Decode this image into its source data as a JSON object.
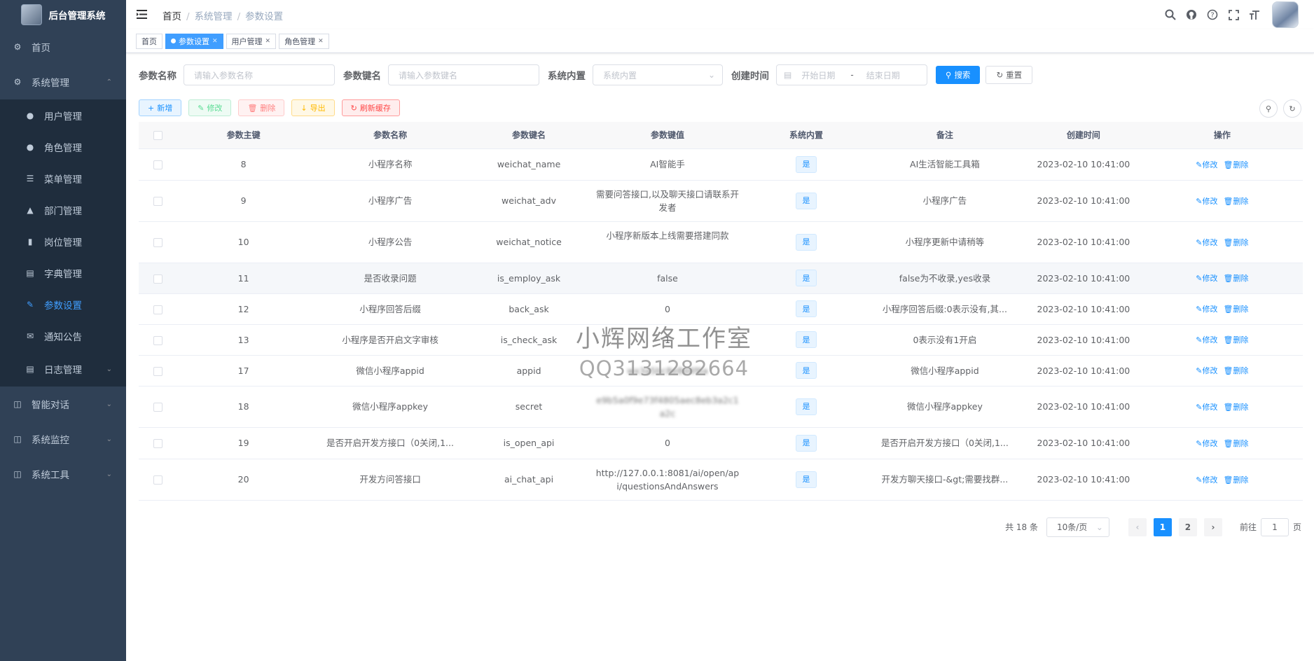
{
  "app": {
    "title": "后台管理系统"
  },
  "sidebar": {
    "home": "首页",
    "system": "系统管理",
    "sub": [
      {
        "label": "用户管理",
        "icon": "user-icon"
      },
      {
        "label": "角色管理",
        "icon": "peoples-icon"
      },
      {
        "label": "菜单管理",
        "icon": "tree-table-icon"
      },
      {
        "label": "部门管理",
        "icon": "tree-icon"
      },
      {
        "label": "岗位管理",
        "icon": "post-icon"
      },
      {
        "label": "字典管理",
        "icon": "dict-icon"
      },
      {
        "label": "参数设置",
        "icon": "edit-icon"
      },
      {
        "label": "通知公告",
        "icon": "message-icon"
      },
      {
        "label": "日志管理",
        "icon": "log-icon"
      }
    ],
    "chat": "智能对话",
    "monitor": "系统监控",
    "tools": "系统工具"
  },
  "breadcrumb": [
    "首页",
    "系统管理",
    "参数设置"
  ],
  "tags": [
    "首页",
    "参数设置",
    "用户管理",
    "角色管理"
  ],
  "search": {
    "name_label": "参数名称",
    "name_ph": "请输入参数名称",
    "key_label": "参数键名",
    "key_ph": "请输入参数键名",
    "type_label": "系统内置",
    "type_ph": "系统内置",
    "date_label": "创建时间",
    "date_start": "开始日期",
    "date_sep": "-",
    "date_end": "结束日期",
    "search_btn": "搜索",
    "reset_btn": "重置"
  },
  "toolbar": {
    "add": "新增",
    "edit": "修改",
    "delete": "删除",
    "export": "导出",
    "refresh": "刷新缓存"
  },
  "table": {
    "headers": [
      "参数主键",
      "参数名称",
      "参数键名",
      "参数键值",
      "系统内置",
      "备注",
      "创建时间",
      "操作"
    ],
    "edit": "修改",
    "del": "删除",
    "rows": [
      {
        "id": "8",
        "name": "小程序名称",
        "key": "weichat_name",
        "value": "AI智能手",
        "type": "是",
        "remark": "AI生活智能工具箱",
        "time": "2023-02-10 10:41:00"
      },
      {
        "id": "9",
        "name": "小程序广告",
        "key": "weichat_adv",
        "value": "需要问答接口,以及聊天接口请联系开发者",
        "type": "是",
        "remark": "小程序广告",
        "time": "2023-02-10 10:41:00"
      },
      {
        "id": "10",
        "name": "小程序公告",
        "key": "weichat_notice",
        "value": "小程序新版本上线需要搭建同款",
        "type": "是",
        "remark": "小程序更新中请稍等",
        "time": "2023-02-10 10:41:00"
      },
      {
        "id": "11",
        "name": "是否收录问题",
        "key": "is_employ_ask",
        "value": "false",
        "type": "是",
        "remark": "false为不收录,yes收录",
        "time": "2023-02-10 10:41:00"
      },
      {
        "id": "12",
        "name": "小程序回答后缀",
        "key": "back_ask",
        "value": "0",
        "type": "是",
        "remark": "小程序回答后缀:0表示没有,其...",
        "time": "2023-02-10 10:41:00"
      },
      {
        "id": "13",
        "name": "小程序是否开启文字审核",
        "key": "is_check_ask",
        "value": "1",
        "type": "是",
        "remark": "0表示没有1开启",
        "time": "2023-02-10 10:41:00"
      },
      {
        "id": "17",
        "name": "微信小程序appid",
        "key": "appid",
        "value": "wx3a5bc8e8d4f6a",
        "type": "是",
        "remark": "微信小程序appid",
        "time": "2023-02-10 10:41:00"
      },
      {
        "id": "18",
        "name": "微信小程序appkey",
        "key": "secret",
        "value": "e9b5a0f9e73f4805aec8eb3a2c1a2c",
        "type": "是",
        "remark": "微信小程序appkey",
        "time": "2023-02-10 10:41:00"
      },
      {
        "id": "19",
        "name": "是否开启开发方接口（0关闭,1...",
        "key": "is_open_api",
        "value": "0",
        "type": "是",
        "remark": "是否开启开发方接口（0关闭,1...",
        "time": "2023-02-10 10:41:00"
      },
      {
        "id": "20",
        "name": "开发方问答接口",
        "key": "ai_chat_api",
        "value": "http://127.0.0.1:8081/ai/open/api/questionsAndAnswers",
        "type": "是",
        "remark": "开发方聊天接口-&gt;需要找群...",
        "time": "2023-02-10 10:41:00"
      }
    ]
  },
  "pager": {
    "total": "共 18 条",
    "size": "10条/页",
    "pages": [
      "1",
      "2"
    ],
    "goto": "前往",
    "page_input": "1",
    "page_unit": "页"
  },
  "watermark": {
    "line1": "小辉网络工作室",
    "line2": "QQ3131282664"
  },
  "colors": {
    "sidebar": "#304156",
    "submenu": "#1f2d3d",
    "primary": "#1890ff",
    "active_menu": "#409eff"
  }
}
